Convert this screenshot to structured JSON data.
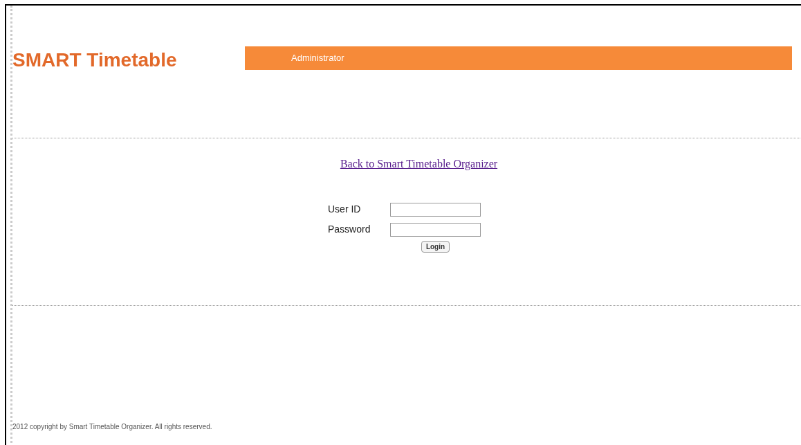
{
  "header": {
    "logo": "SMART Timetable",
    "banner_label": "Administrator"
  },
  "back_link": "Back to Smart Timetable Organizer",
  "login_form": {
    "fields": [
      {
        "label": "User ID"
      },
      {
        "label": "Password"
      }
    ],
    "button": "Login"
  },
  "footer": "2012 copyright by Smart Timetable Organizer. All rights reserved."
}
